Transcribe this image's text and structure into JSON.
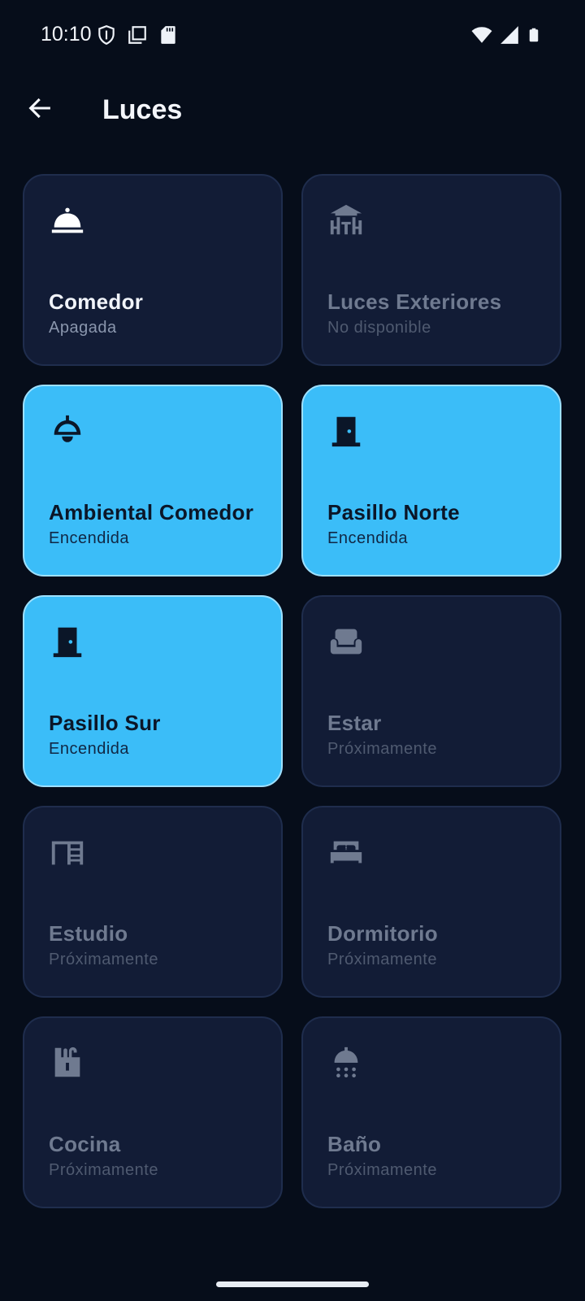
{
  "status_bar": {
    "time": "10:10",
    "left_icons": [
      "vpn-shield-icon",
      "screenshot-icon",
      "sd-card-icon"
    ],
    "right_icons": [
      "wifi-icon",
      "signal-icon",
      "battery-icon"
    ]
  },
  "app_bar": {
    "back_icon": "arrow-left-icon",
    "title": "Luces"
  },
  "rooms": [
    {
      "name": "Comedor",
      "state": "Apagada",
      "icon": "cloche-icon",
      "status": "off"
    },
    {
      "name": "Luces Exteriores",
      "state": "No disponible",
      "icon": "outdoor-pavilion-icon",
      "status": "disabled"
    },
    {
      "name": "Ambiental Comedor",
      "state": "Encendida",
      "icon": "pendant-lamp-icon",
      "status": "on"
    },
    {
      "name": "Pasillo Norte",
      "state": "Encendida",
      "icon": "door-icon",
      "status": "on"
    },
    {
      "name": "Pasillo Sur",
      "state": "Encendida",
      "icon": "door-icon",
      "status": "on"
    },
    {
      "name": "Estar",
      "state": "Próximamente",
      "icon": "sofa-icon",
      "status": "disabled"
    },
    {
      "name": "Estudio",
      "state": "Próximamente",
      "icon": "desk-icon",
      "status": "disabled"
    },
    {
      "name": "Dormitorio",
      "state": "Próximamente",
      "icon": "bed-icon",
      "status": "disabled"
    },
    {
      "name": "Cocina",
      "state": "Próximamente",
      "icon": "kitchen-counter-icon",
      "status": "disabled"
    },
    {
      "name": "Baño",
      "state": "Próximamente",
      "icon": "shower-icon",
      "status": "disabled"
    }
  ],
  "colors": {
    "background": "#060d1a",
    "card_off": "#121c36",
    "card_on": "#3bbdf8"
  }
}
